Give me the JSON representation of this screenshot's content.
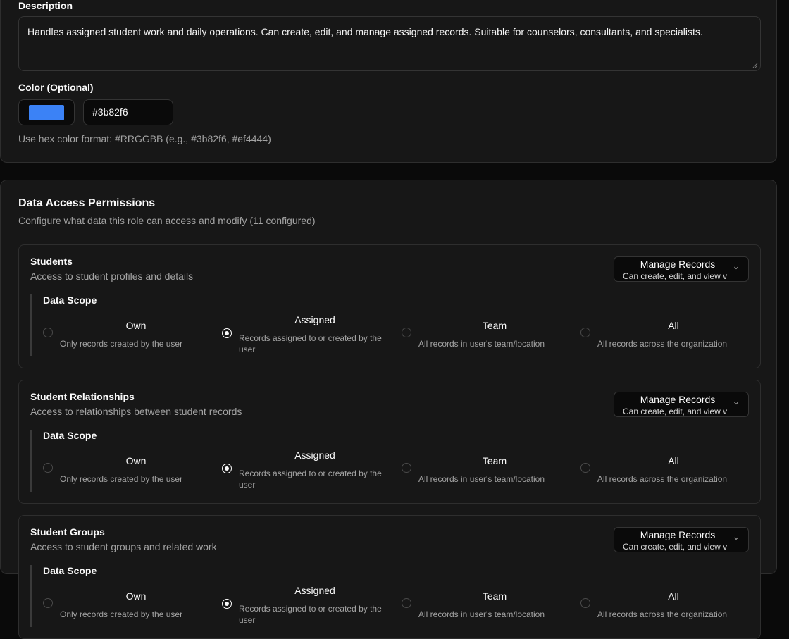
{
  "role_form": {
    "description_label": "Description",
    "description_value": "Handles assigned student work and daily operations. Can create, edit, and manage assigned records. Suitable for counselors, consultants, and specialists.",
    "color_label": "Color (Optional)",
    "color_value": "#3b82f6",
    "color_hint": "Use hex color format: #RRGGBB (e.g., #3b82f6, #ef4444)"
  },
  "permissions": {
    "title": "Data Access Permissions",
    "subtitle": "Configure what data this role can access and modify (11 configured)",
    "scope_label": "Data Scope",
    "sections": [
      {
        "title": "Students",
        "description": "Access to student profiles and details",
        "level": "Manage Records",
        "level_desc": "Can create, edit, and view v",
        "selected_scope": "Assigned"
      },
      {
        "title": "Student Relationships",
        "description": "Access to relationships between student records",
        "level": "Manage Records",
        "level_desc": "Can create, edit, and view v",
        "selected_scope": "Assigned"
      },
      {
        "title": "Student Groups",
        "description": "Access to student groups and related work",
        "level": "Manage Records",
        "level_desc": "Can create, edit, and view v",
        "selected_scope": "Assigned"
      }
    ],
    "scope_options": [
      {
        "label": "Own",
        "desc": "Only records created by the user"
      },
      {
        "label": "Assigned",
        "desc": "Records assigned to or created by the user"
      },
      {
        "label": "Team",
        "desc": "All records in user's team/location"
      },
      {
        "label": "All",
        "desc": "All records across the organization"
      }
    ]
  },
  "colors": {
    "background": "#0a0a0a",
    "card": "#171717",
    "border": "#2e2e2e",
    "accent_swatch": "#3b82f6"
  }
}
